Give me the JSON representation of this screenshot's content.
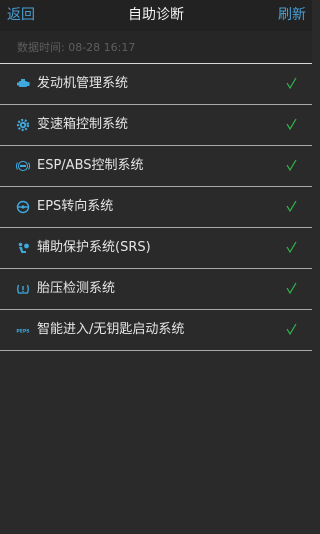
{
  "header": {
    "back_label": "返回",
    "title": "自助诊断",
    "refresh_label": "刷新"
  },
  "timestamp": "数据时间: 08-28 16:17",
  "colors": {
    "accent": "#4a9fd5",
    "icon": "#3fa9df",
    "ok": "#2fb84a",
    "background": "#2a2a2a"
  },
  "systems": [
    {
      "label": "发动机管理系统",
      "icon": "engine-icon",
      "status": "√"
    },
    {
      "label": "变速箱控制系统",
      "icon": "gearbox-icon",
      "status": "√"
    },
    {
      "label": "ESP/ABS控制系统",
      "icon": "abs-icon",
      "status": "√"
    },
    {
      "label": "EPS转向系统",
      "icon": "steering-wheel-icon",
      "status": "√"
    },
    {
      "label": "辅助保护系统(SRS)",
      "icon": "airbag-icon",
      "status": "√"
    },
    {
      "label": "胎压检测系统",
      "icon": "tire-pressure-icon",
      "status": "√"
    },
    {
      "label": "智能进入/无钥匙启动系统",
      "icon": "keyless-entry-icon",
      "icon_text": "PEPS",
      "status": "√"
    }
  ]
}
